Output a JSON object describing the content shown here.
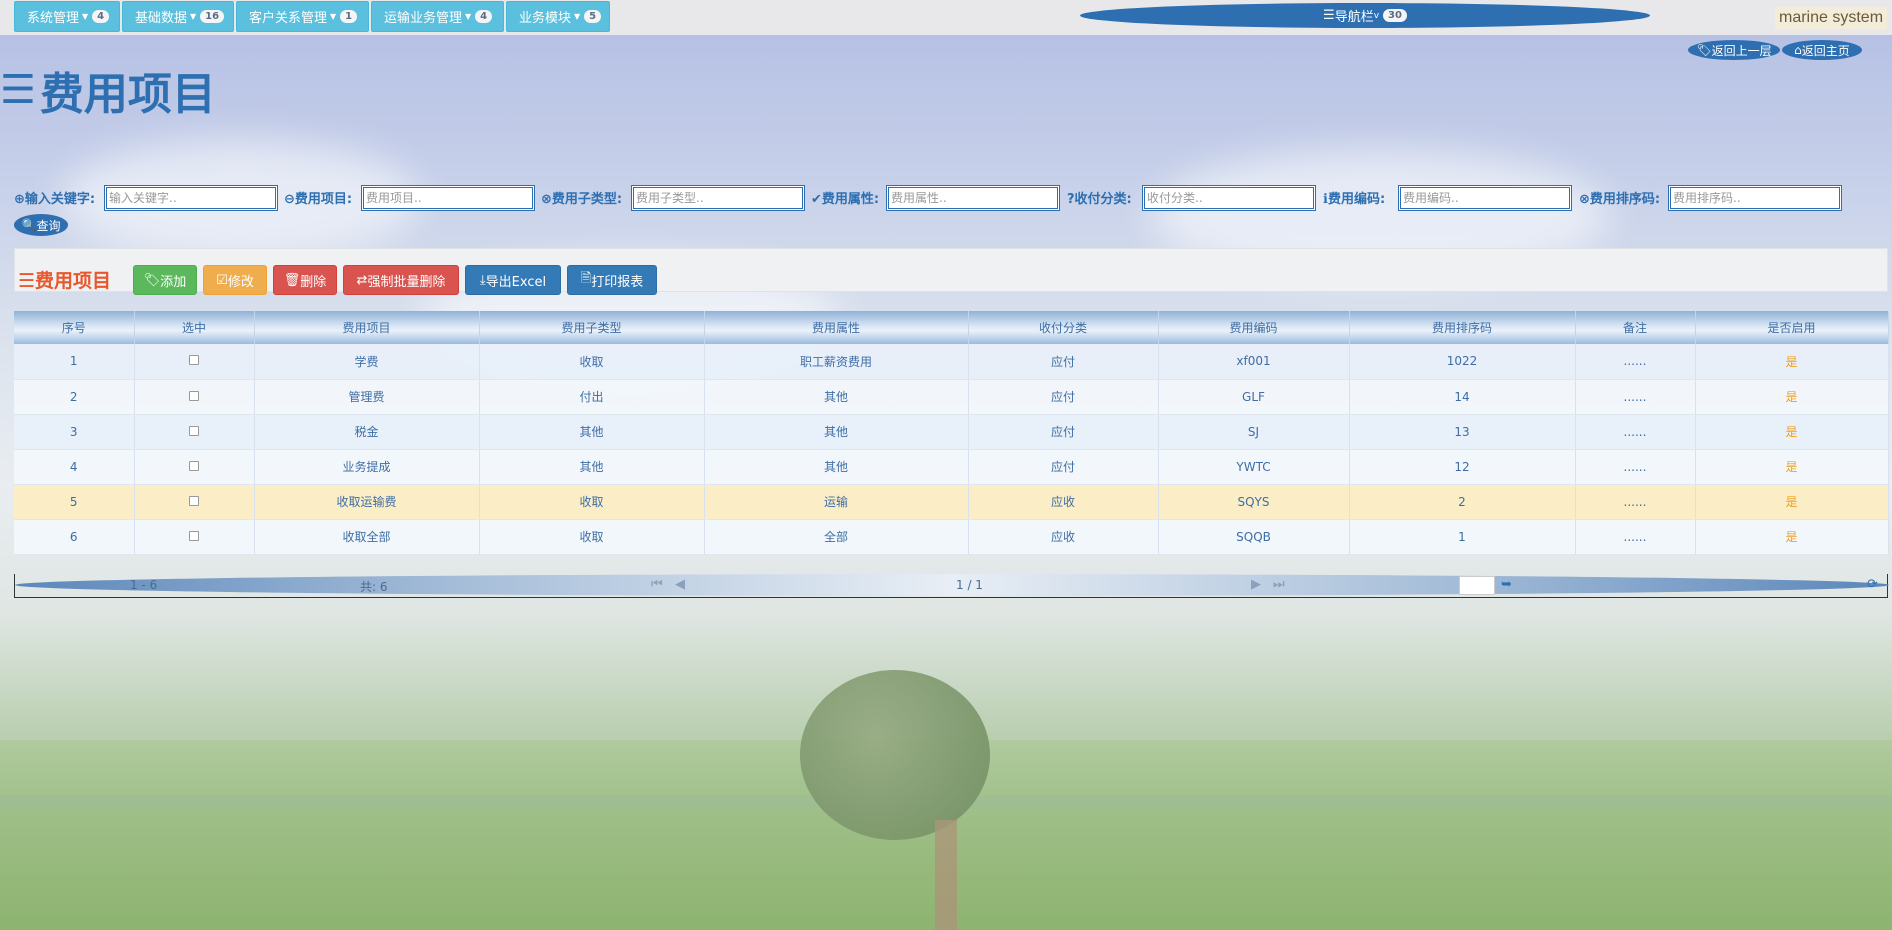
{
  "menu": [
    {
      "label": "系统管理",
      "badge": "4"
    },
    {
      "label": "基础数据",
      "badge": "16"
    },
    {
      "label": "客户关系管理",
      "badge": "1"
    },
    {
      "label": "运输业务管理",
      "badge": "4"
    },
    {
      "label": "业务模块",
      "badge": "5"
    }
  ],
  "navbar": {
    "label": "导航栏",
    "badge": "30"
  },
  "brand": "marine system",
  "back": {
    "up": "返回上一层",
    "home": "返回主页"
  },
  "page_title": "费用项目",
  "search": {
    "keyword": {
      "label": "输入关键字:",
      "placeholder": "输入关键字.."
    },
    "item": {
      "label": "费用项目:",
      "placeholder": "费用项目.."
    },
    "subtype": {
      "label": "费用子类型:",
      "placeholder": "费用子类型.."
    },
    "attr": {
      "label": "费用属性:",
      "placeholder": "费用属性.."
    },
    "category": {
      "label": "收付分类:",
      "placeholder": "收付分类.."
    },
    "code": {
      "label": "费用编码:",
      "placeholder": "费用编码.."
    },
    "sort": {
      "label": "费用排序码:",
      "placeholder": "费用排序码.."
    },
    "query": "查询"
  },
  "toolbar": {
    "title": "费用项目",
    "add": "添加",
    "edit": "修改",
    "delete": "删除",
    "force_delete": "强制批量删除",
    "export": "导出Excel",
    "print": "打印报表"
  },
  "table": {
    "headers": [
      "序号",
      "选中",
      "费用项目",
      "费用子类型",
      "费用属性",
      "收付分类",
      "费用编码",
      "费用排序码",
      "备注",
      "是否启用"
    ],
    "rows": [
      {
        "no": "1",
        "item": "学费",
        "subtype": "收取",
        "attr": "职工薪资费用",
        "category": "应付",
        "code": "xf001",
        "sort": "1022",
        "remark": "......",
        "enabled": "是"
      },
      {
        "no": "2",
        "item": "管理费",
        "subtype": "付出",
        "attr": "其他",
        "category": "应付",
        "code": "GLF",
        "sort": "14",
        "remark": "......",
        "enabled": "是"
      },
      {
        "no": "3",
        "item": "税金",
        "subtype": "其他",
        "attr": "其他",
        "category": "应付",
        "code": "SJ",
        "sort": "13",
        "remark": "......",
        "enabled": "是"
      },
      {
        "no": "4",
        "item": "业务提成",
        "subtype": "其他",
        "attr": "其他",
        "category": "应付",
        "code": "YWTC",
        "sort": "12",
        "remark": "......",
        "enabled": "是"
      },
      {
        "no": "5",
        "item": "收取运输费",
        "subtype": "收取",
        "attr": "运输",
        "category": "应收",
        "code": "SQYS",
        "sort": "2",
        "remark": "......",
        "enabled": "是"
      },
      {
        "no": "6",
        "item": "收取全部",
        "subtype": "收取",
        "attr": "全部",
        "category": "应收",
        "code": "SQQB",
        "sort": "1",
        "remark": "......",
        "enabled": "是"
      }
    ]
  },
  "pager": {
    "range": "1 - 6",
    "total": "共: 6",
    "page": "1 / 1"
  },
  "colors": {
    "primary": "#2d6fb0",
    "accent_orange": "#e8582c",
    "enabled_yellow": "#f0a020"
  }
}
